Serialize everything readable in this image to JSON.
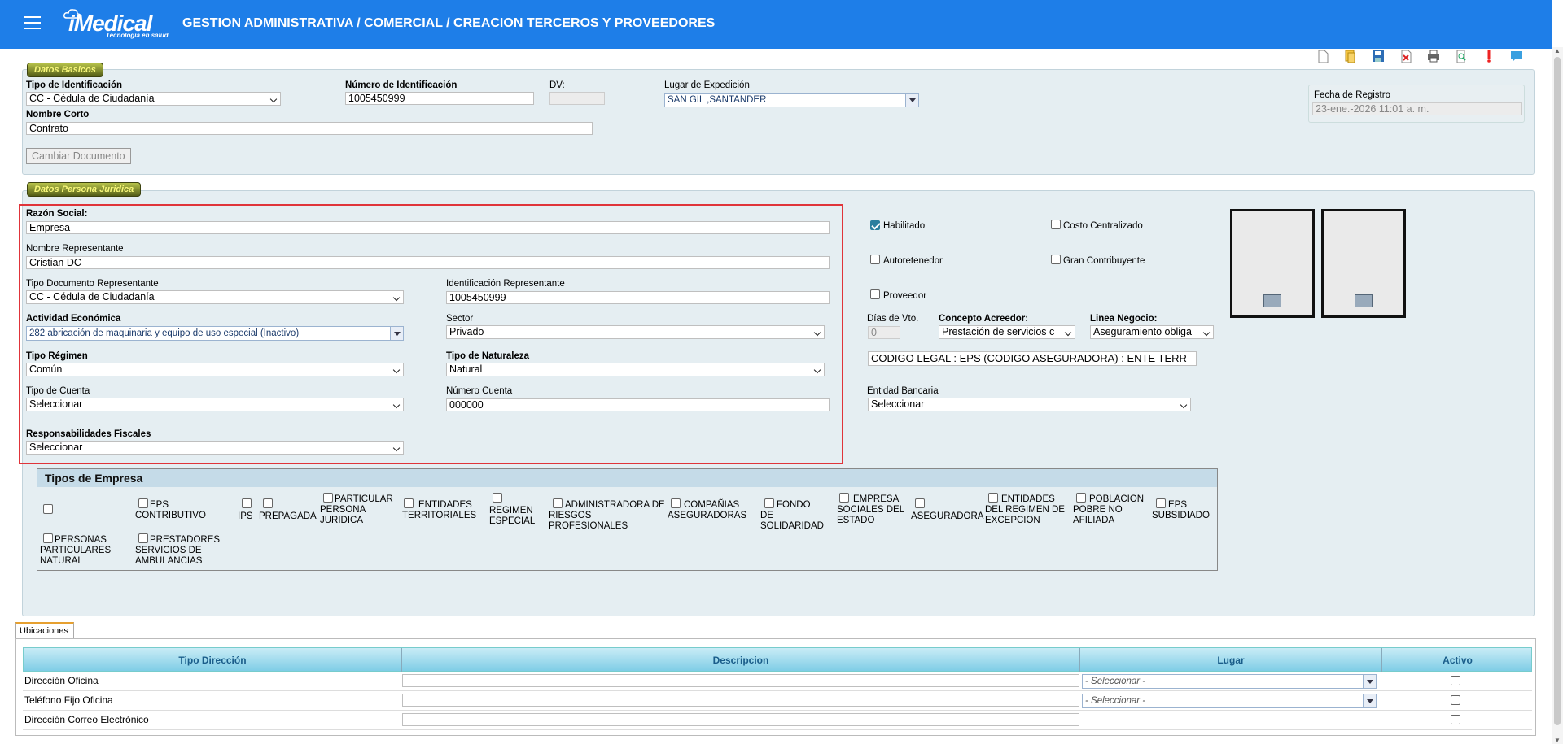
{
  "header": {
    "logo_main": "iMedical",
    "logo_sub": "Tecnología en salud",
    "breadcrumb": "GESTION ADMINISTRATIVA  /  COMERCIAL  /  CREACION TERCEROS Y PROVEEDORES"
  },
  "datos_basicos": {
    "legend": "Datos Basicos",
    "tipo_id_label": "Tipo de Identificación",
    "tipo_id_value": "CC - Cédula de Ciudadanía",
    "numero_id_label": "Número de Identificación",
    "numero_id_value": "1005450999",
    "dv_label": "DV:",
    "dv_value": "",
    "lugar_label": "Lugar de Expedición",
    "lugar_value": "SAN GIL ,SANTANDER",
    "nombre_corto_label": "Nombre Corto",
    "nombre_corto_value": "Contrato",
    "cambiar_doc": "Cambiar Documento",
    "fecha_label": "Fecha de Registro",
    "fecha_value": "23-ene.-2026 11:01 a. m."
  },
  "persona_juridica": {
    "legend": "Datos Persona Juridica",
    "razon_social_label": "Razón Social:",
    "razon_social_value": "Empresa",
    "nombre_rep_label": "Nombre Representante",
    "nombre_rep_value": "Cristian DC",
    "tipo_doc_rep_label": "Tipo Documento Representante",
    "tipo_doc_rep_value": "CC - Cédula de Ciudadanía",
    "id_rep_label": "Identificación Representante",
    "id_rep_value": "1005450999",
    "actividad_label": "Actividad Económica",
    "actividad_value": "282  abricación de maquinaria y equipo de uso especial (Inactivo)",
    "sector_label": "Sector",
    "sector_value": "Privado",
    "tipo_regimen_label": "Tipo Régimen",
    "tipo_regimen_value": "Común",
    "tipo_naturaleza_label": "Tipo de Naturaleza",
    "tipo_naturaleza_value": "Natural",
    "tipo_cuenta_label": "Tipo de Cuenta",
    "tipo_cuenta_value": "Seleccionar",
    "numero_cuenta_label": "Número Cuenta",
    "numero_cuenta_value": "000000",
    "resp_fiscales_label": "Responsabilidades Fiscales",
    "resp_fiscales_value": "Seleccionar",
    "habilitado": "Habilitado",
    "costo_centralizado": "Costo Centralizado",
    "autoretenedor": "Autoretenedor",
    "gran_contribuyente": "Gran Contribuyente",
    "proveedor": "Proveedor",
    "dias_vto_label": "Días de Vto.",
    "dias_vto_value": "0",
    "concepto_label": "Concepto Acreedor:",
    "concepto_value": "Prestación de servicios c",
    "linea_label": "Linea Negocio:",
    "linea_value": "Aseguramiento obliga",
    "codigo_legal": "CODIGO LEGAL : EPS (CODIGO ASEGURADORA) : ENTE TERR",
    "entidad_label": "Entidad Bancaria",
    "entidad_value": "Seleccionar"
  },
  "tipos_empresa": {
    "title": "Tipos de Empresa",
    "items": [
      "",
      "EPS CONTRIBUTIVO",
      "IPS",
      "PREPAGADA",
      "PARTICULAR PERSONA JURIDICA",
      "ENTIDADES TERRITORIALES",
      "REGIMEN ESPECIAL",
      "ADMINISTRADORA DE RIESGOS PROFESIONALES",
      "COMPAÑIAS ASEGURADORAS",
      "FONDO DE SOLIDARIDAD",
      "EMPRESA SOCIALES DEL ESTADO",
      "ASEGURADORA",
      "ENTIDADES DEL REGIMEN DE EXCEPCION",
      "POBLACION POBRE NO AFILIADA",
      "EPS SUBSIDIADO",
      "PERSONAS PARTICULARES NATURAL",
      "PRESTADORES SERVICIOS DE AMBULANCIAS"
    ]
  },
  "ubicaciones": {
    "tab": "Ubicaciones",
    "columns": [
      "Tipo Dirección",
      "Descripcion",
      "Lugar",
      "Activo"
    ],
    "rows": [
      {
        "tipo": "Dirección Oficina",
        "lugar": "- Seleccionar -"
      },
      {
        "tipo": "Teléfono Fijo Oficina",
        "lugar": "- Seleccionar -"
      },
      {
        "tipo": "Dirección Correo Electrónico",
        "lugar": ""
      }
    ]
  },
  "colors": {
    "header": "#1e7ee8",
    "panel": "#e5eef2",
    "highlight": "#e0343a"
  }
}
